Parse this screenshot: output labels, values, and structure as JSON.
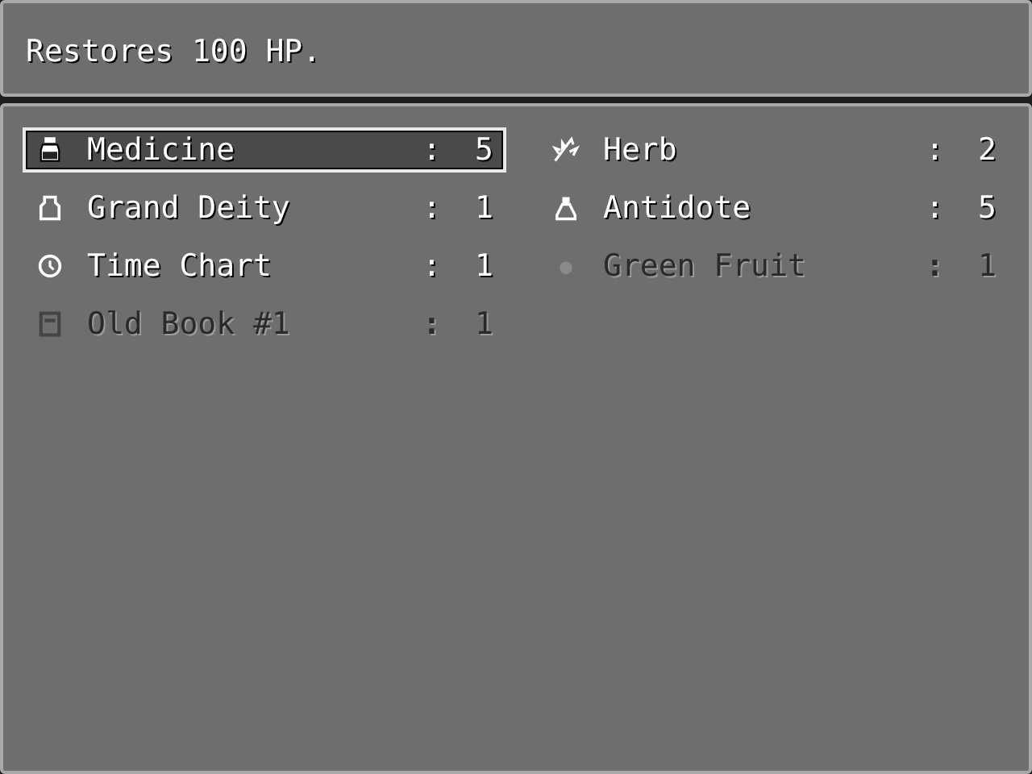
{
  "help_window": {
    "text": "Restores 100 HP."
  },
  "items": [
    {
      "kind": "bottle",
      "name": "Medicine",
      "colon": ":",
      "count": "5",
      "selected": true,
      "disabled": false
    },
    {
      "kind": "herb",
      "name": "Herb",
      "colon": ":",
      "count": "2",
      "selected": false,
      "disabled": false
    },
    {
      "kind": "pot",
      "name": "Grand Deity",
      "colon": ":",
      "count": "1",
      "selected": false,
      "disabled": false
    },
    {
      "kind": "flask",
      "name": "Antidote",
      "colon": ":",
      "count": "5",
      "selected": false,
      "disabled": false
    },
    {
      "kind": "clock",
      "name": "Time Chart",
      "colon": ":",
      "count": "1",
      "selected": false,
      "disabled": false
    },
    {
      "kind": "fruit",
      "name": "Green Fruit",
      "colon": ":",
      "count": "1",
      "selected": false,
      "disabled": true
    },
    {
      "kind": "book",
      "name": "Old Book #1",
      "colon": ":",
      "count": "1",
      "selected": false,
      "disabled": true
    }
  ]
}
